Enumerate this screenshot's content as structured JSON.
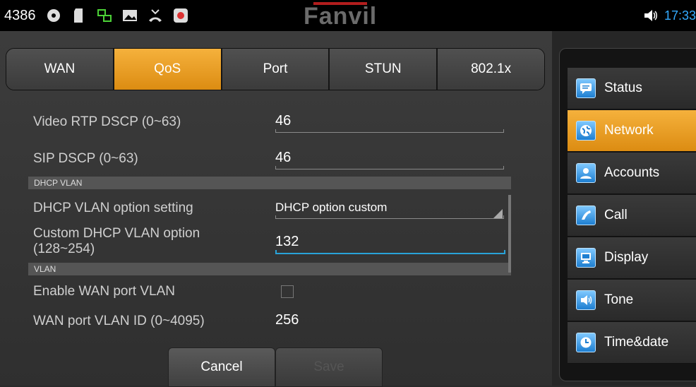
{
  "statusbar": {
    "extension": "4386",
    "icons": [
      "disc-icon",
      "sdcard-icon",
      "network-icon",
      "image-icon",
      "missed-call-icon",
      "record-icon"
    ],
    "brand": "Fanvil",
    "time": "17:33",
    "volume_icon": "speaker-icon"
  },
  "tabs": [
    {
      "label": "WAN",
      "active": false
    },
    {
      "label": "QoS",
      "active": true
    },
    {
      "label": "Port",
      "active": false
    },
    {
      "label": "STUN",
      "active": false
    },
    {
      "label": "802.1x",
      "active": false
    }
  ],
  "form": {
    "video_rtp_dscp": {
      "label": "Video RTP DSCP (0~63)",
      "value": "46"
    },
    "sip_dscp": {
      "label": "SIP DSCP (0~63)",
      "value": "46"
    },
    "section_dhcp_vlan": "DHCP VLAN",
    "dhcp_vlan_option": {
      "label": "DHCP VLAN option setting",
      "value": "DHCP option custom"
    },
    "custom_dhcp_vlan": {
      "label_line1": "Custom DHCP VLAN option",
      "label_line2": "(128~254)",
      "value": "132"
    },
    "section_vlan": "VLAN",
    "enable_wan_vlan": {
      "label": "Enable WAN port VLAN",
      "checked": false
    },
    "wan_vlan_id": {
      "label": "WAN port VLAN ID (0~4095)",
      "value": "256"
    }
  },
  "buttons": {
    "cancel": "Cancel",
    "save": "Save"
  },
  "sidebar": {
    "items": [
      {
        "label": "Status",
        "icon": "chat-icon",
        "active": false
      },
      {
        "label": "Network",
        "icon": "globe-icon",
        "active": true
      },
      {
        "label": "Accounts",
        "icon": "user-icon",
        "active": false
      },
      {
        "label": "Call",
        "icon": "phone-icon",
        "active": false
      },
      {
        "label": "Display",
        "icon": "monitor-icon",
        "active": false
      },
      {
        "label": "Tone",
        "icon": "speaker-icon",
        "active": false
      },
      {
        "label": "Time&date",
        "icon": "clock-icon",
        "active": false
      }
    ]
  },
  "colors": {
    "accent": "#e89a1f",
    "focus": "#29a3d9",
    "time": "#33aaff",
    "brand_red": "#b21d1d"
  }
}
